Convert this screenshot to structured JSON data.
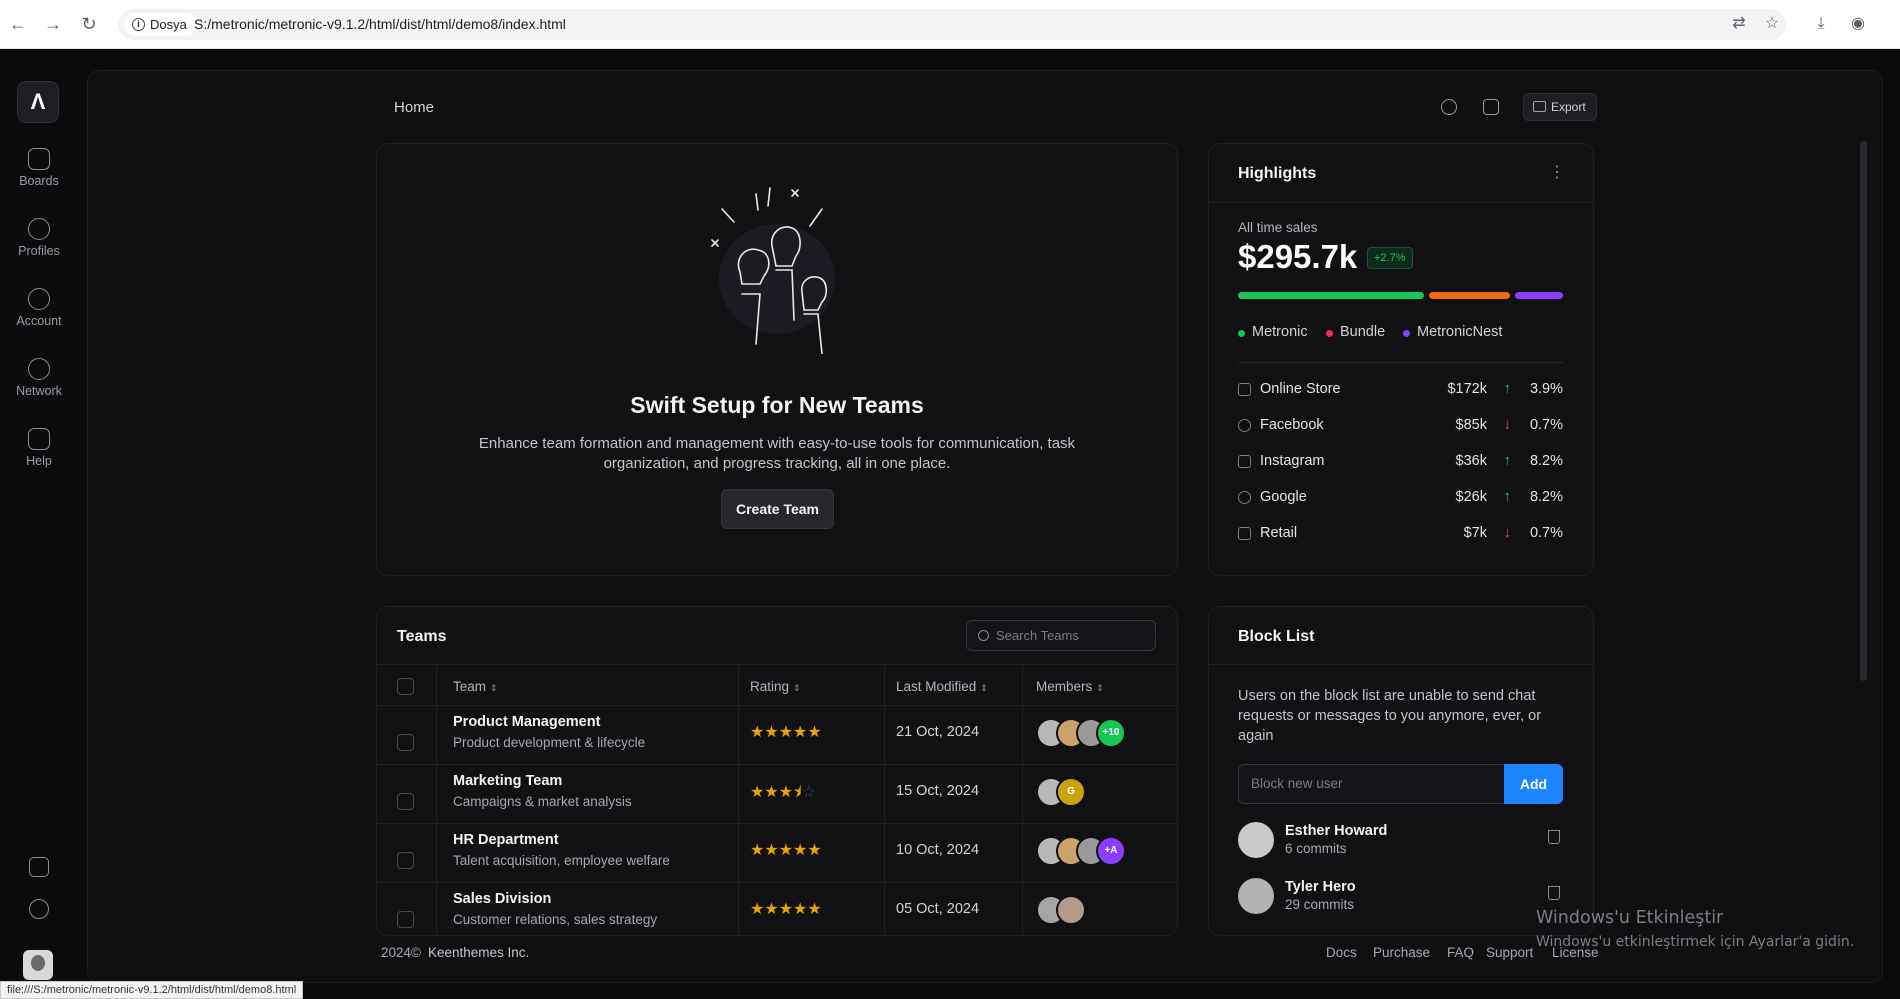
{
  "browser": {
    "chip_label": "Dosya",
    "url": "S:/metronic/metronic-v9.1.2/html/dist/html/demo8/index.html",
    "status_url": "file:///S:/metronic/metronic-v9.1.2/html/dist/html/demo8.html"
  },
  "sidebar": {
    "logo": "Λ",
    "items": [
      {
        "label": "Boards",
        "icon": "boards-icon"
      },
      {
        "label": "Profiles",
        "icon": "profiles-icon"
      },
      {
        "label": "Account",
        "icon": "gear-icon"
      },
      {
        "label": "Network",
        "icon": "network-icon"
      },
      {
        "label": "Help",
        "icon": "help-icon"
      }
    ]
  },
  "header": {
    "title": "Home",
    "export_label": "Export"
  },
  "hero": {
    "title": "Swift Setup for New Teams",
    "description": "Enhance team formation and management with easy-to-use tools for communication, task organization, and progress tracking, all in one place.",
    "button": "Create Team"
  },
  "highlights": {
    "title": "Highlights",
    "label": "All time sales",
    "value": "$295.7k",
    "badge": "+2.7%",
    "bar_colors": [
      "#17c653",
      "#f06a10",
      "#8b3dff"
    ],
    "bar_fractions": [
      0.58,
      0.25,
      0.15
    ],
    "legend": [
      {
        "name": "Metronic",
        "color": "#17c653"
      },
      {
        "name": "Bundle",
        "color": "#f8285a"
      },
      {
        "name": "MetronicNest",
        "color": "#8b3dff"
      }
    ],
    "rows": [
      {
        "name": "Online Store",
        "amount": "$172k",
        "trend": "up",
        "pct": "3.9%"
      },
      {
        "name": "Facebook",
        "amount": "$85k",
        "trend": "down",
        "pct": "0.7%"
      },
      {
        "name": "Instagram",
        "amount": "$36k",
        "trend": "up",
        "pct": "8.2%"
      },
      {
        "name": "Google",
        "amount": "$26k",
        "trend": "up",
        "pct": "8.2%"
      },
      {
        "name": "Retail",
        "amount": "$7k",
        "trend": "down",
        "pct": "0.7%"
      }
    ]
  },
  "teams": {
    "title": "Teams",
    "search_placeholder": "Search Teams",
    "columns": [
      "Team",
      "Rating",
      "Last Modified",
      "Members"
    ],
    "rows": [
      {
        "name": "Product Management",
        "desc": "Product development & lifecycle",
        "rating": 5,
        "date": "21 Oct, 2024",
        "members": [
          "a",
          "a",
          "a",
          "+10"
        ]
      },
      {
        "name": "Marketing Team",
        "desc": "Campaigns & market analysis",
        "rating": 3.5,
        "date": "15 Oct, 2024",
        "members": [
          "a",
          "G"
        ]
      },
      {
        "name": "HR Department",
        "desc": "Talent acquisition, employee welfare",
        "rating": 5,
        "date": "10 Oct, 2024",
        "members": [
          "a",
          "a",
          "a",
          "+A"
        ]
      },
      {
        "name": "Sales Division",
        "desc": "Customer relations, sales strategy",
        "rating": 5,
        "date": "05 Oct, 2024",
        "members": [
          "a",
          "a"
        ]
      }
    ]
  },
  "blocklist": {
    "title": "Block List",
    "description": "Users on the block list are unable to send chat requests or messages to you anymore, ever, or again",
    "input_placeholder": "Block new user",
    "add_label": "Add",
    "users": [
      {
        "name": "Esther Howard",
        "commits": "6 commits"
      },
      {
        "name": "Tyler Hero",
        "commits": "29 commits"
      }
    ]
  },
  "footer": {
    "copyright": "2024©",
    "company": "Keenthemes Inc.",
    "links": [
      "Docs",
      "Purchase",
      "FAQ",
      "Support",
      "License"
    ]
  },
  "watermark": {
    "title": "Windows'u Etkinleştir",
    "subtitle": "Windows'u etkinleştirmek için Ayarlar'a gidin."
  }
}
